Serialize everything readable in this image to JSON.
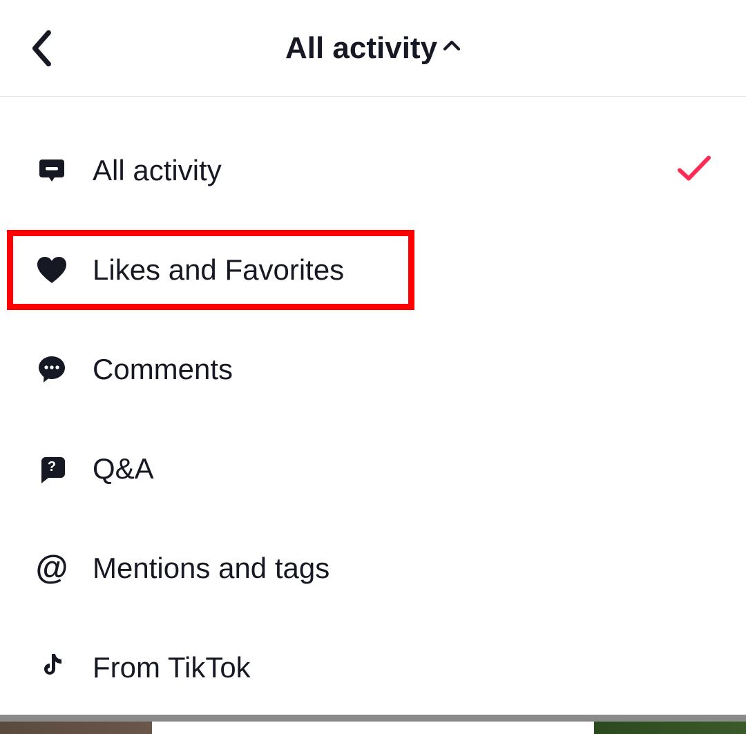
{
  "header": {
    "title": "All activity"
  },
  "menu": {
    "items": [
      {
        "label": "All activity",
        "icon": "chat-bubble-icon",
        "selected": true,
        "highlighted": false
      },
      {
        "label": "Likes and Favorites",
        "icon": "heart-icon",
        "selected": false,
        "highlighted": true
      },
      {
        "label": "Comments",
        "icon": "comments-icon",
        "selected": false,
        "highlighted": false
      },
      {
        "label": "Q&A",
        "icon": "qa-icon",
        "selected": false,
        "highlighted": false
      },
      {
        "label": "Mentions and tags",
        "icon": "at-icon",
        "selected": false,
        "highlighted": false
      },
      {
        "label": "From TikTok",
        "icon": "tiktok-icon",
        "selected": false,
        "highlighted": false
      }
    ]
  },
  "colors": {
    "check": "#FE2C55",
    "highlight": "#FF0000",
    "text": "#161823"
  }
}
